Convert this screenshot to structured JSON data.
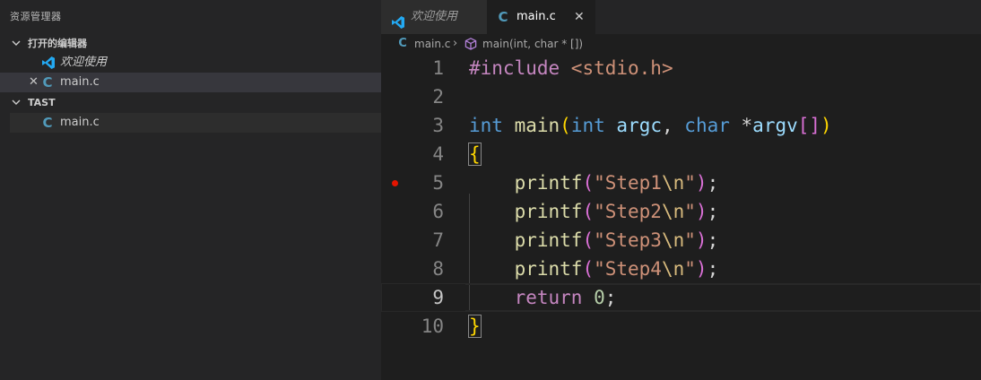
{
  "explorer": {
    "title": "资源管理器",
    "open_editors": {
      "header": "打开的编辑器",
      "items": [
        {
          "label": "欢迎使用",
          "icon": "vscode-logo-icon"
        },
        {
          "label": "main.c",
          "icon": "c-file-icon",
          "close": "✕"
        }
      ]
    },
    "folder": {
      "header": "TAST",
      "items": [
        {
          "label": "main.c",
          "icon": "c-file-icon"
        }
      ]
    }
  },
  "tabs": [
    {
      "label": "欢迎使用",
      "icon": "vscode-logo-icon",
      "active": false
    },
    {
      "label": "main.c",
      "icon": "c-file-icon",
      "active": true,
      "close": "✕"
    }
  ],
  "breadcrumb": {
    "file": "main.c",
    "separator": "›",
    "symbol": "main(int, char * [])"
  },
  "code": {
    "line_numbers": [
      "1",
      "2",
      "3",
      "4",
      "5",
      "6",
      "7",
      "8",
      "9",
      "10"
    ],
    "breakpoint_line": 5,
    "current_line": 9,
    "lines": [
      [
        {
          "t": "#include ",
          "c": "t-pre"
        },
        {
          "t": "<stdio.h>",
          "c": "t-inc"
        }
      ],
      [],
      [
        {
          "t": "int",
          "c": "t-kw"
        },
        {
          "t": " ",
          "c": "t-pun"
        },
        {
          "t": "main",
          "c": "t-fn"
        },
        {
          "t": "(",
          "c": "t-br1"
        },
        {
          "t": "int",
          "c": "t-kw"
        },
        {
          "t": " ",
          "c": "t-pun"
        },
        {
          "t": "argc",
          "c": "t-var"
        },
        {
          "t": ", ",
          "c": "t-pun"
        },
        {
          "t": "char",
          "c": "t-kw"
        },
        {
          "t": " *",
          "c": "t-pun"
        },
        {
          "t": "argv",
          "c": "t-var"
        },
        {
          "t": "[]",
          "c": "t-br2"
        },
        {
          "t": ")",
          "c": "t-br1"
        }
      ],
      [
        {
          "t": "{",
          "c": "t-br1 brace-match"
        }
      ],
      [
        {
          "t": "    ",
          "c": "t-pun"
        },
        {
          "t": "printf",
          "c": "t-fn"
        },
        {
          "t": "(",
          "c": "t-br2"
        },
        {
          "t": "\"Step1",
          "c": "t-str"
        },
        {
          "t": "\\n",
          "c": "t-esc"
        },
        {
          "t": "\"",
          "c": "t-str"
        },
        {
          "t": ")",
          "c": "t-br2"
        },
        {
          "t": ";",
          "c": "t-pun"
        }
      ],
      [
        {
          "t": "    ",
          "c": "t-pun"
        },
        {
          "t": "printf",
          "c": "t-fn"
        },
        {
          "t": "(",
          "c": "t-br2"
        },
        {
          "t": "\"Step2",
          "c": "t-str"
        },
        {
          "t": "\\n",
          "c": "t-esc"
        },
        {
          "t": "\"",
          "c": "t-str"
        },
        {
          "t": ")",
          "c": "t-br2"
        },
        {
          "t": ";",
          "c": "t-pun"
        }
      ],
      [
        {
          "t": "    ",
          "c": "t-pun"
        },
        {
          "t": "printf",
          "c": "t-fn"
        },
        {
          "t": "(",
          "c": "t-br2"
        },
        {
          "t": "\"Step3",
          "c": "t-str"
        },
        {
          "t": "\\n",
          "c": "t-esc"
        },
        {
          "t": "\"",
          "c": "t-str"
        },
        {
          "t": ")",
          "c": "t-br2"
        },
        {
          "t": ";",
          "c": "t-pun"
        }
      ],
      [
        {
          "t": "    ",
          "c": "t-pun"
        },
        {
          "t": "printf",
          "c": "t-fn"
        },
        {
          "t": "(",
          "c": "t-br2"
        },
        {
          "t": "\"Step4",
          "c": "t-str"
        },
        {
          "t": "\\n",
          "c": "t-esc"
        },
        {
          "t": "\"",
          "c": "t-str"
        },
        {
          "t": ")",
          "c": "t-br2"
        },
        {
          "t": ";",
          "c": "t-pun"
        }
      ],
      [
        {
          "t": "    ",
          "c": "t-pun"
        },
        {
          "t": "return",
          "c": "t-ctl"
        },
        {
          "t": " ",
          "c": "t-pun"
        },
        {
          "t": "0",
          "c": "t-num"
        },
        {
          "t": ";",
          "c": "t-pun"
        }
      ],
      [
        {
          "t": "}",
          "c": "t-br1 brace-match"
        }
      ]
    ]
  },
  "colors": {
    "accent": "#007acc",
    "c_icon": "#519aba",
    "breakpoint": "#e51400"
  }
}
